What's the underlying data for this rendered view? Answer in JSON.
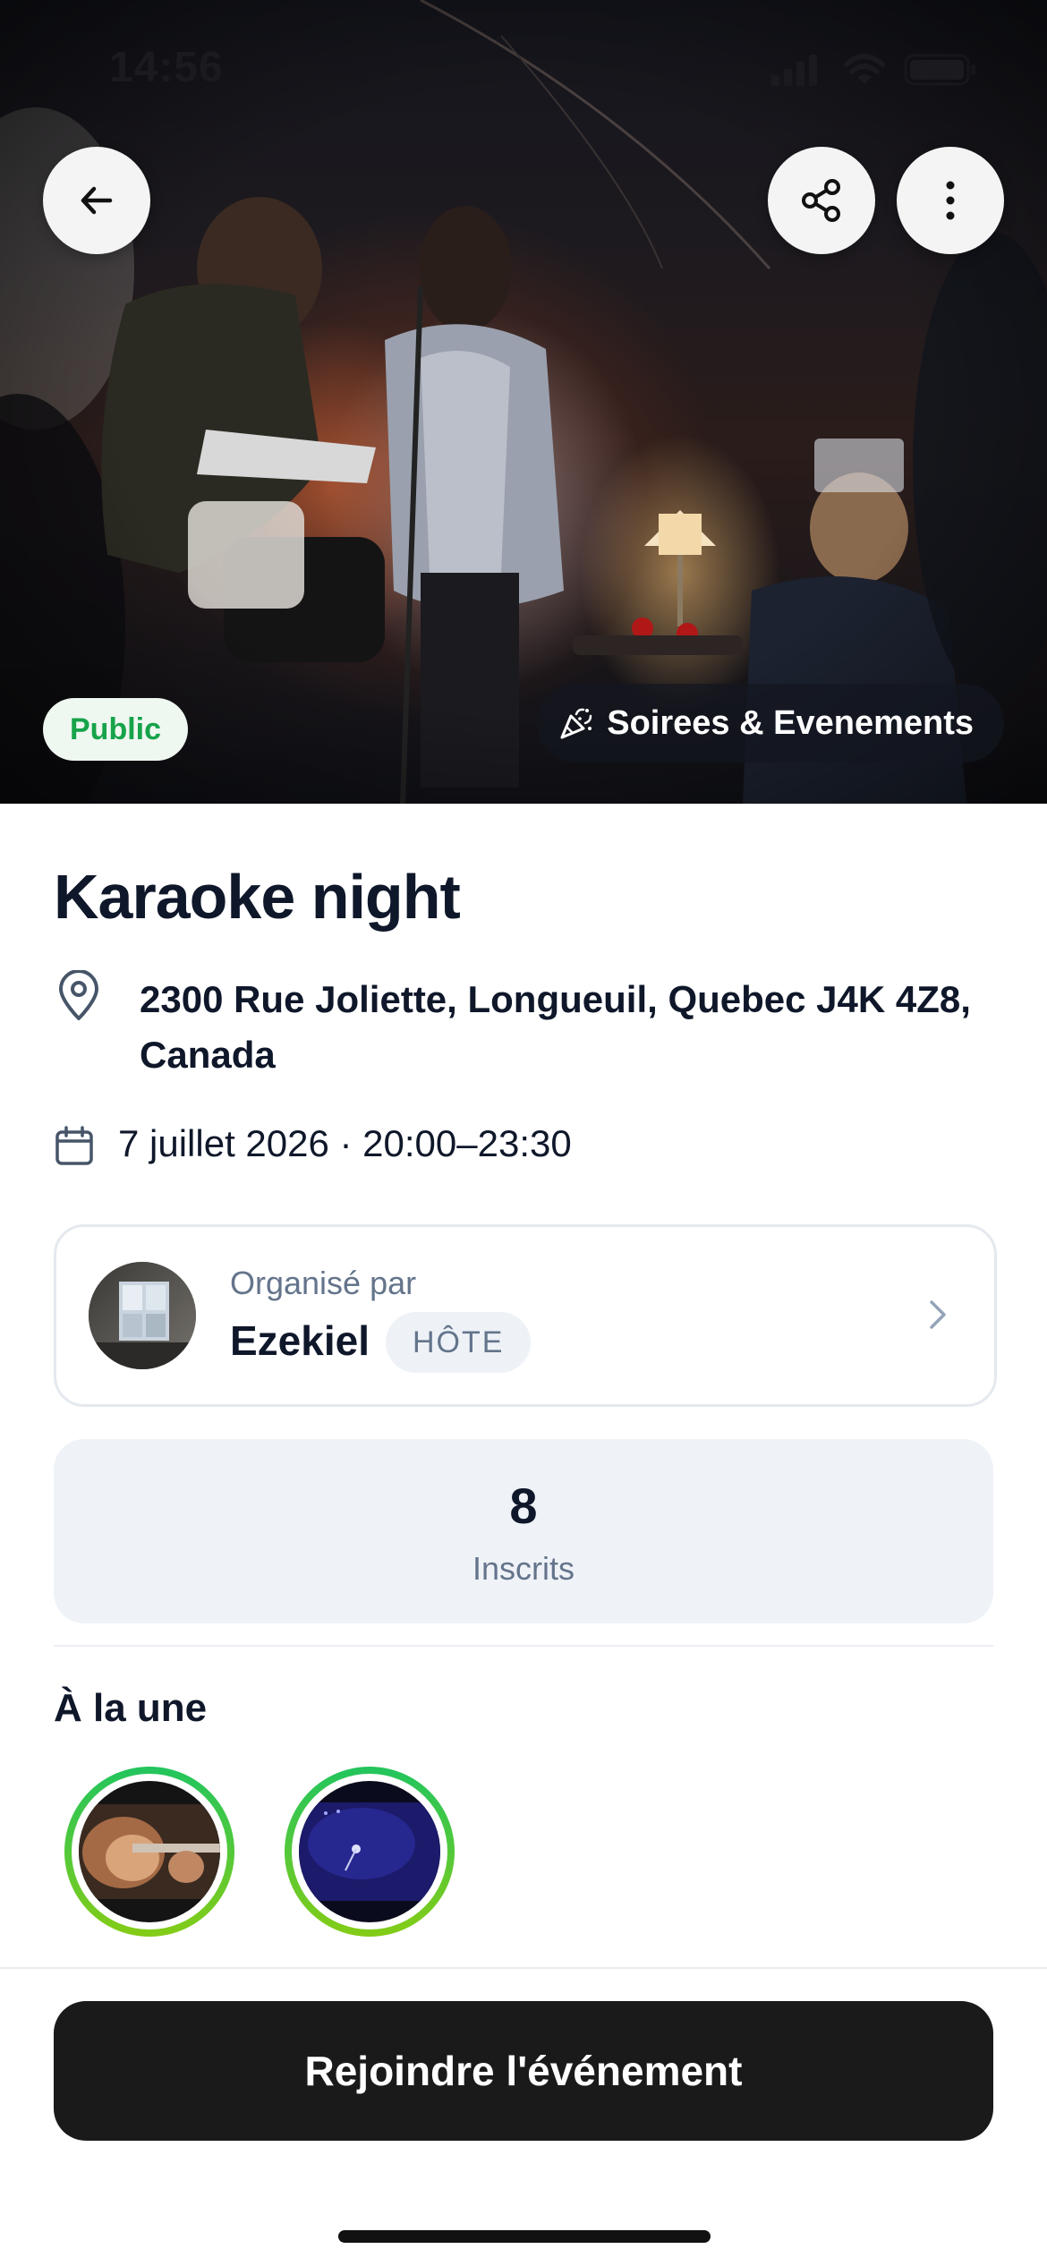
{
  "status_bar": {
    "time": "14:56"
  },
  "hero": {
    "visibility_label": "Public",
    "category_label": "Soirees & Evenements",
    "category_icon": "party-popper-icon"
  },
  "actions": {
    "back_icon": "arrow-left-icon",
    "share_icon": "share-icon",
    "more_icon": "more-vertical-icon"
  },
  "event": {
    "title": "Karaoke night",
    "address": "2300 Rue Joliette, Longueuil, Quebec J4K 4Z8, Canada",
    "datetime": "7 juillet 2026 · 20:00–23:30"
  },
  "organizer": {
    "label": "Organisé par",
    "name": "Ezekiel",
    "badge": "HÔTE"
  },
  "stats": {
    "count": "8",
    "label": "Inscrits"
  },
  "featured": {
    "title": "À la une",
    "ring_colors": [
      "#22c55e",
      "#84cc16"
    ]
  },
  "cta": {
    "join_label": "Rejoindre l'événement"
  },
  "colors": {
    "public_green": "#16a34a",
    "cta_bg": "#1a1a1a",
    "muted_text": "#64748b",
    "card_bg": "#eff3f8"
  }
}
